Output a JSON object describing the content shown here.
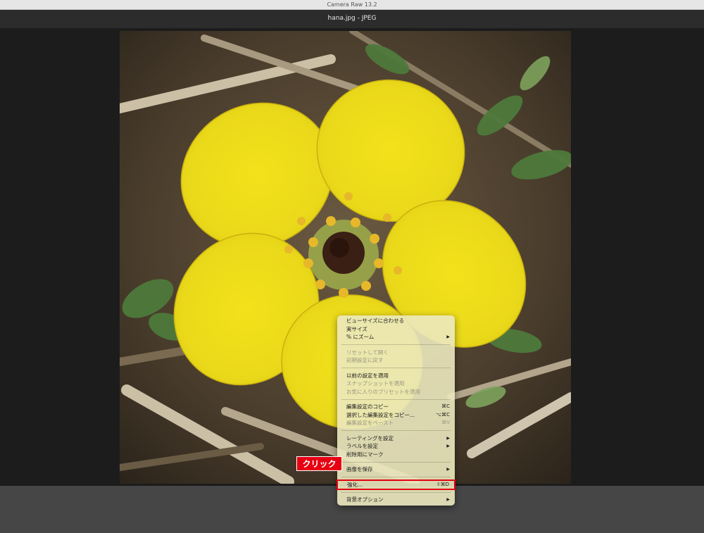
{
  "app": {
    "title": "Camera Raw 13.2"
  },
  "document": {
    "header": "hana.jpg  -  JPEG"
  },
  "photo": {
    "subject": "yellow-flower-photo"
  },
  "menu": {
    "groups": [
      [
        {
          "label": "ビューサイズに合わせる",
          "shortcut": "",
          "submenu": false,
          "enabled": true
        },
        {
          "label": "実サイズ",
          "shortcut": "",
          "submenu": false,
          "enabled": true
        },
        {
          "label": "% にズーム",
          "shortcut": "",
          "submenu": true,
          "enabled": true
        }
      ],
      [
        {
          "label": "リセットして開く",
          "shortcut": "",
          "submenu": false,
          "enabled": false
        },
        {
          "label": "初期設定に戻す",
          "shortcut": "",
          "submenu": false,
          "enabled": false
        }
      ],
      [
        {
          "label": "以前の設定を適用",
          "shortcut": "",
          "submenu": false,
          "enabled": true
        },
        {
          "label": "スナップショットを適用",
          "shortcut": "",
          "submenu": false,
          "enabled": false
        },
        {
          "label": "お気に入りのプリセットを適用",
          "shortcut": "",
          "submenu": false,
          "enabled": false
        }
      ],
      [
        {
          "label": "編集設定のコピー",
          "shortcut": "⌘C",
          "submenu": false,
          "enabled": true
        },
        {
          "label": "選択した編集設定をコピー...",
          "shortcut": "⌥⌘C",
          "submenu": false,
          "enabled": true
        },
        {
          "label": "編集設定をペースト",
          "shortcut": "⌘V",
          "submenu": false,
          "enabled": false
        }
      ],
      [
        {
          "label": "レーティングを設定",
          "shortcut": "",
          "submenu": true,
          "enabled": true
        },
        {
          "label": "ラベルを設定",
          "shortcut": "",
          "submenu": true,
          "enabled": true
        },
        {
          "label": "削除用にマーク",
          "shortcut": "",
          "submenu": false,
          "enabled": true
        }
      ],
      [
        {
          "label": "画像を保存",
          "shortcut": "",
          "submenu": true,
          "enabled": true
        }
      ],
      [
        {
          "label": "強化...",
          "shortcut": "⇧⌘D",
          "submenu": false,
          "enabled": true,
          "highlighted": true
        }
      ],
      [
        {
          "label": "背景オプション",
          "shortcut": "",
          "submenu": true,
          "enabled": true
        }
      ]
    ],
    "submenu_arrow": "▶"
  },
  "callout": {
    "text": "クリック",
    "color": "#e60012"
  },
  "colors": {
    "accent_red": "#e60012",
    "menu_bg": "#ebe8be"
  }
}
